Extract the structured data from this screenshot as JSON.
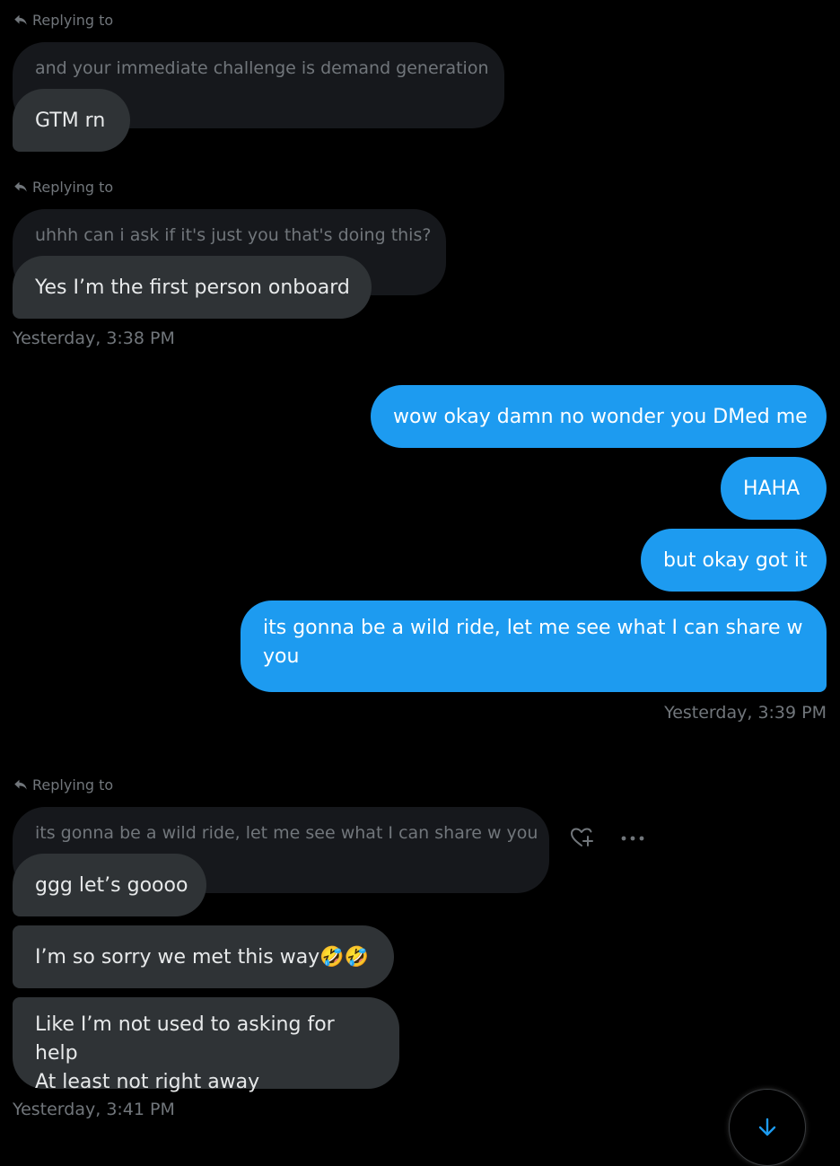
{
  "reply_label": "Replying to",
  "groups": [
    {
      "quoted": "and your immediate challenge is demand generation",
      "reply": "GTM rn"
    },
    {
      "quoted": "uhhh can i ask if it's just you that's doing this?",
      "reply": "Yes I’m the first person onboard",
      "timestamp": "Yesterday, 3:38 PM"
    }
  ],
  "sent_messages": [
    "wow okay damn no wonder you DMed me",
    "HAHA",
    "but okay got it",
    "its gonna be a wild ride, let me see what I can share w you"
  ],
  "sent_timestamp": "Yesterday, 3:39 PM",
  "last_group": {
    "quoted": "its gonna be a wild ride, let me see what I can share w you",
    "reply": "ggg let’s goooo",
    "messages": [
      {
        "text": "I’m so sorry we met this way",
        "emoji": "🤣🤣"
      },
      {
        "line1": "Like I’m not used to asking for help",
        "line2": "At least not right away"
      }
    ],
    "timestamp": "Yesterday, 3:41 PM"
  },
  "icons": {
    "reply_arrow": "reply-arrow-icon",
    "react": "heart-plus-icon",
    "more": "more-icon",
    "scroll": "arrow-down-icon"
  },
  "colors": {
    "background": "#000000",
    "incoming_bubble": "#2f3336",
    "quoted_bubble": "#16181c",
    "outgoing_bubble": "#1d9bf0",
    "muted_text": "#71767b",
    "accent": "#1d9bf0"
  }
}
